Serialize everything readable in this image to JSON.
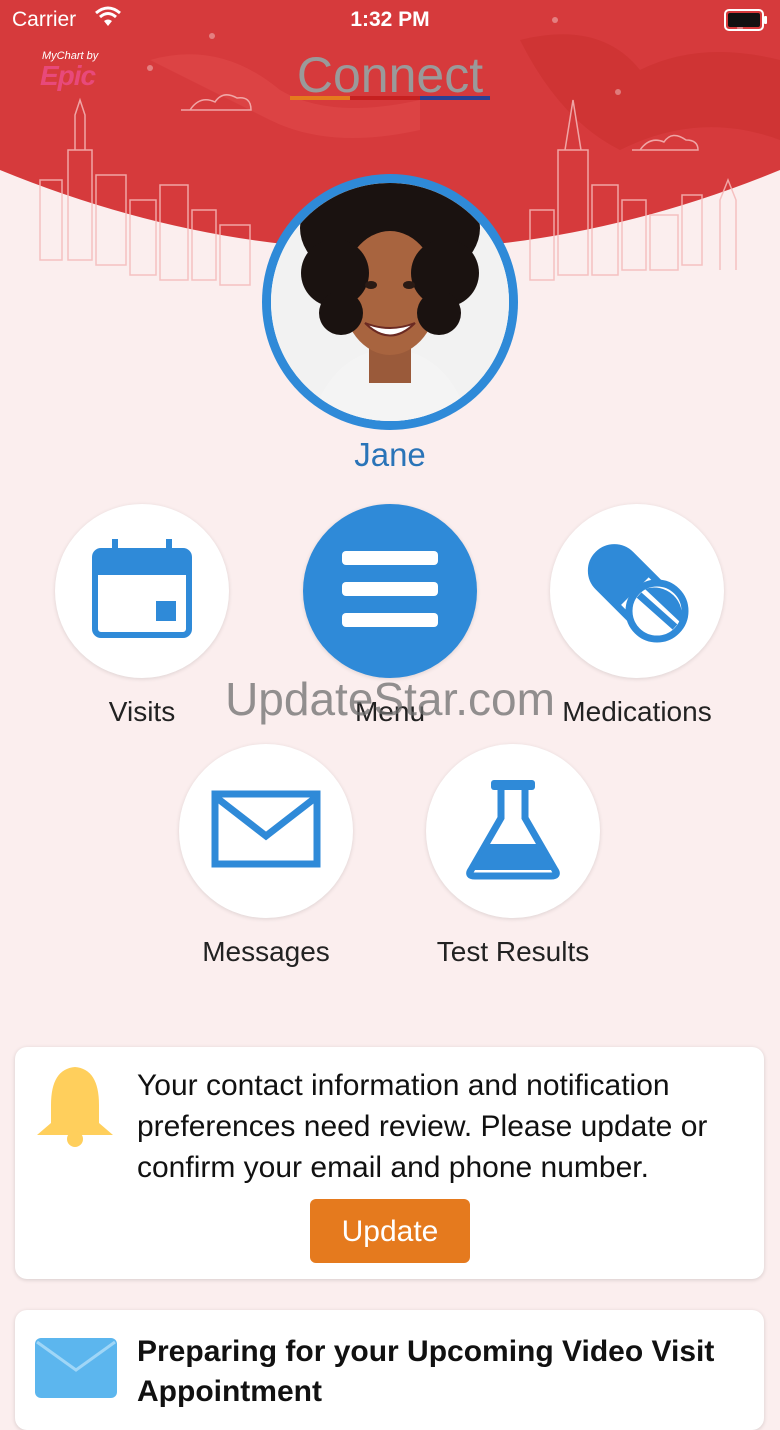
{
  "status_bar": {
    "carrier": "Carrier",
    "time": "1:32 PM"
  },
  "header": {
    "logo_small": "MyChart by",
    "logo_big": "Epic",
    "brand": "Connect"
  },
  "patient": {
    "name": "Jane"
  },
  "actions": [
    {
      "label": "Visits",
      "icon": "calendar-icon"
    },
    {
      "label": "Menu",
      "icon": "menu-icon"
    },
    {
      "label": "Medications",
      "icon": "pill-icon"
    },
    {
      "label": "Messages",
      "icon": "envelope-icon"
    },
    {
      "label": "Test Results",
      "icon": "flask-icon"
    }
  ],
  "watermark": "UpdateStar.com",
  "notification_card": {
    "icon": "bell-icon",
    "message": "Your contact information and notification preferences need review. Please update or confirm your email and phone number.",
    "button_label": "Update"
  },
  "video_card": {
    "icon": "mail-icon",
    "heading": "Preparing for your Upcoming Video Visit Appointment"
  },
  "colors": {
    "header_red": "#d63a3c",
    "accent_blue": "#2f8ad8",
    "update_orange": "#e57a1e",
    "bell_yellow": "#ffcf5c",
    "background": "#fbeeee"
  }
}
